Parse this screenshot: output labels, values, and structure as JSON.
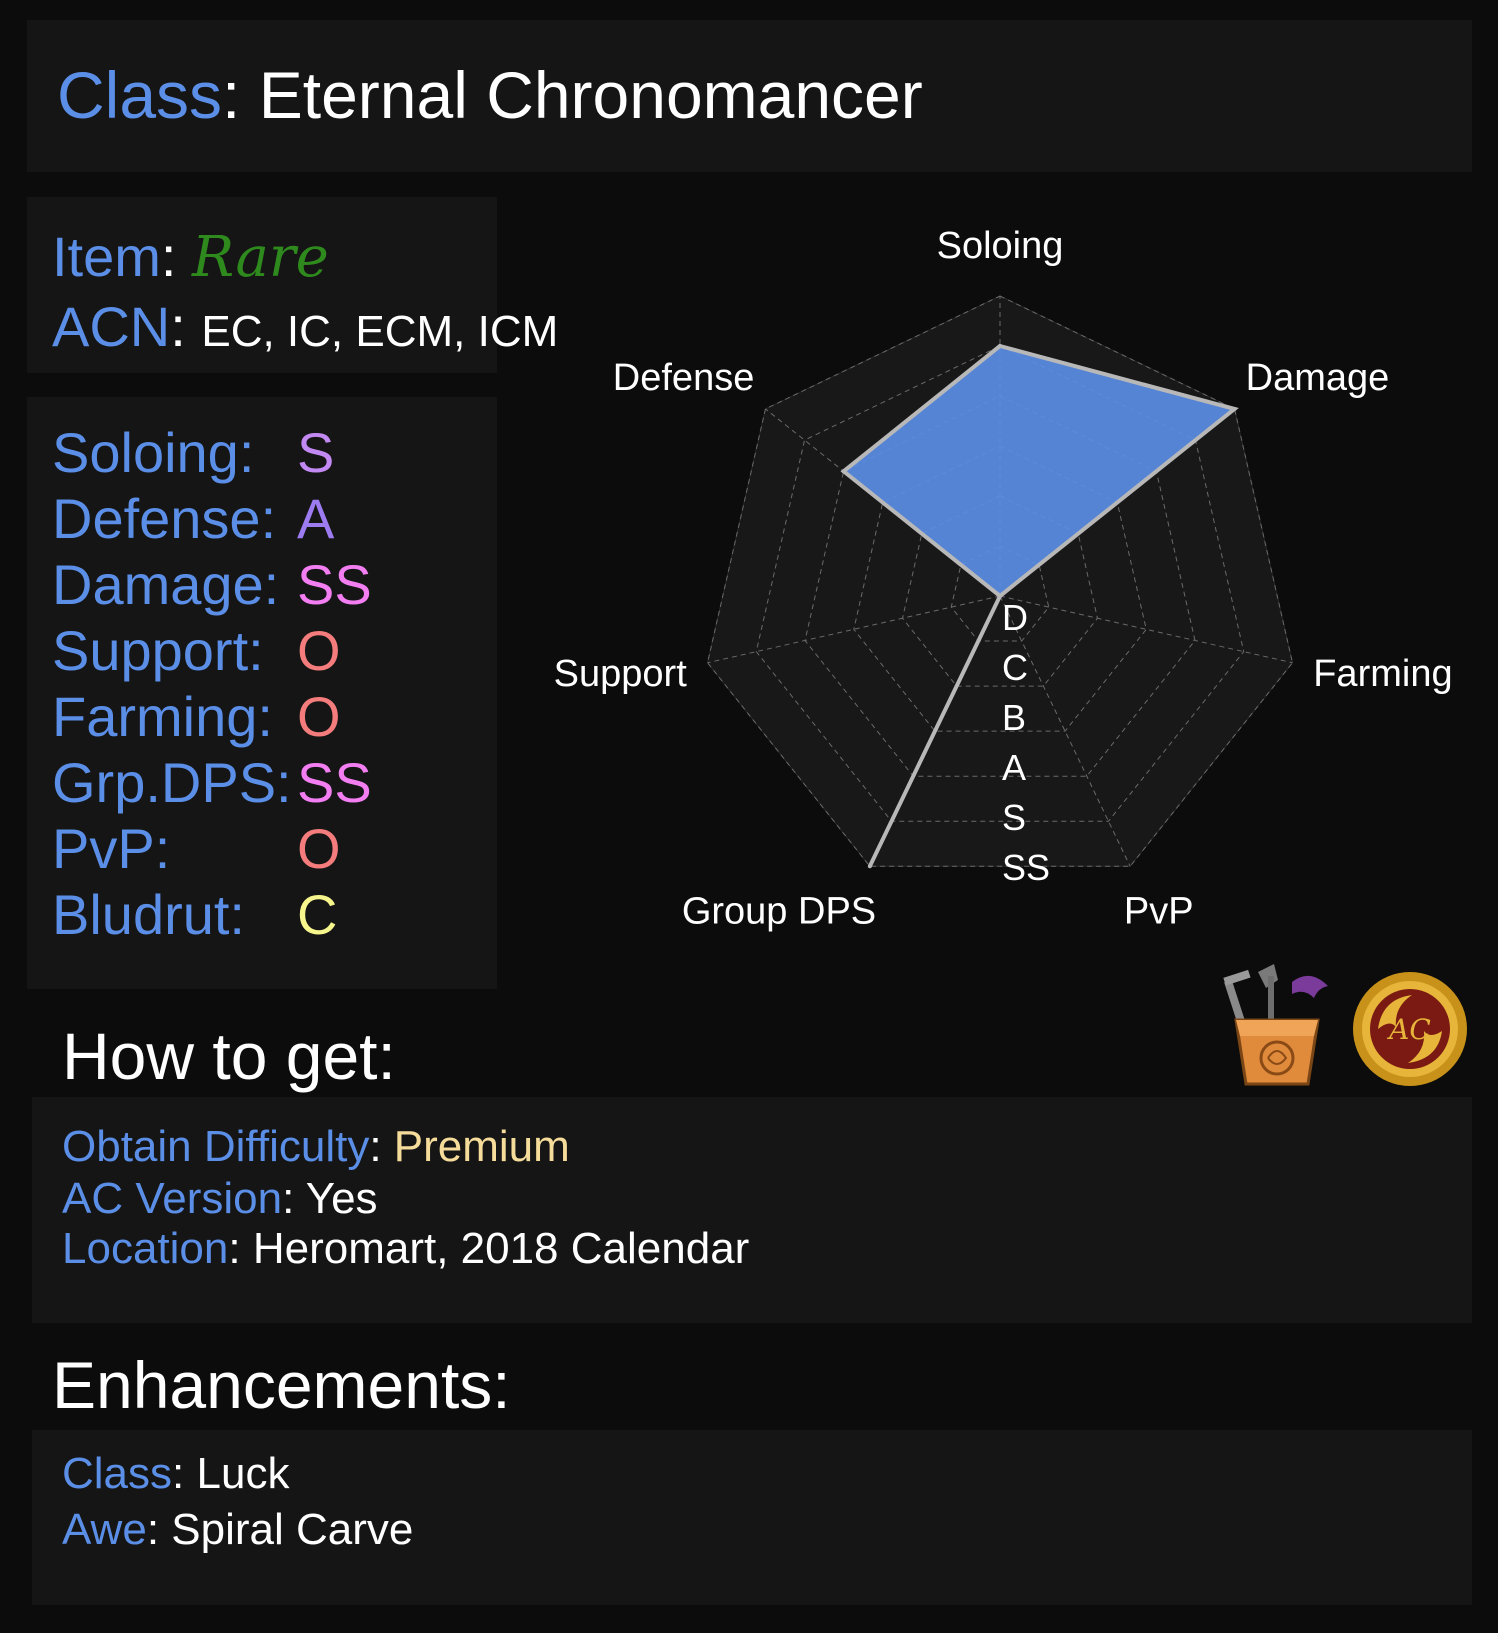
{
  "class_panel": {
    "label": "Class",
    "sep": ":",
    "name": "Eternal Chronomancer"
  },
  "item": {
    "label": "Item",
    "sep": ":",
    "value": "Rare"
  },
  "acn": {
    "label": "ACN",
    "sep": ":",
    "value": "EC, IC, ECM, ICM"
  },
  "ratings": [
    {
      "label": "Soloing:",
      "grade": "S",
      "color": "#c389f2"
    },
    {
      "label": "Defense:",
      "grade": "A",
      "color": "#9c7cf0"
    },
    {
      "label": "Damage:",
      "grade": "SS",
      "color": "#f27ef2"
    },
    {
      "label": "Support:",
      "grade": "O",
      "color": "#f47c7c"
    },
    {
      "label": "Farming:",
      "grade": "O",
      "color": "#f47c7c"
    },
    {
      "label": "Grp.DPS:",
      "grade": "SS",
      "color": "#f27ef2"
    },
    {
      "label": "PvP:",
      "grade": "O",
      "color": "#f47c7c"
    },
    {
      "label": "Bludrut:",
      "grade": "C",
      "color": "#f6f68c"
    }
  ],
  "chart_data": {
    "type": "radar",
    "axes": [
      "Soloing",
      "Damage",
      "Farming",
      "PvP",
      "Group DPS",
      "Support",
      "Defense"
    ],
    "scale_labels": [
      "D",
      "C",
      "B",
      "A",
      "S",
      "SS"
    ],
    "scale_max": 6,
    "values": [
      5,
      6,
      0,
      0,
      6,
      0,
      4
    ],
    "fill_color": "#5b8ee6",
    "stroke_color": "#b8b8b8",
    "grid": true
  },
  "how_to_get": {
    "heading": "How to get:",
    "difficulty_label": "Obtain Difficulty",
    "difficulty_value": "Premium",
    "ac_label": "AC Version",
    "ac_value": "Yes",
    "location_label": "Location",
    "location_value": "Heromart, 2018 Calendar",
    "sep": ":"
  },
  "enhancements": {
    "heading": "Enhancements:",
    "class_label": "Class",
    "class_value": "Luck",
    "awe_label": "Awe",
    "awe_value": "Spiral Carve",
    "sep": ":"
  },
  "icons": {
    "shop": "heromart-bag-icon",
    "ac": "ac-coin-icon"
  }
}
